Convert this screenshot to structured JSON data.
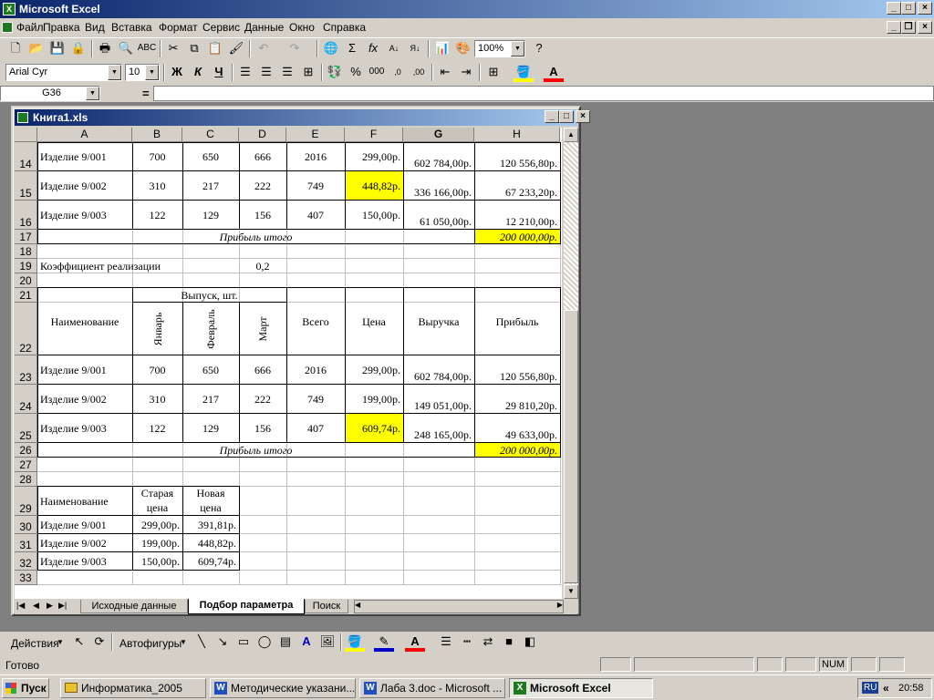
{
  "app": {
    "title": "Microsoft Excel"
  },
  "menu": [
    "Файл",
    "Правка",
    "Вид",
    "Вставка",
    "Формат",
    "Сервис",
    "Данные",
    "Окно",
    "Справка"
  ],
  "toolbar": {
    "zoom": "100%"
  },
  "format": {
    "font": "Arial Cyr",
    "size": "10",
    "thousands": "000"
  },
  "formula_bar": {
    "name_box": "G36",
    "equals": "="
  },
  "workbook": {
    "title": "Книга1.xls"
  },
  "columns": [
    "A",
    "B",
    "C",
    "D",
    "E",
    "F",
    "G",
    "H"
  ],
  "rows": [
    "14",
    "15",
    "16",
    "17",
    "18",
    "19",
    "20",
    "21",
    "22",
    "23",
    "24",
    "25",
    "26",
    "27",
    "28",
    "29",
    "30",
    "31",
    "32",
    "33"
  ],
  "table1": [
    {
      "name": "Изделие 9/001",
      "b": "700",
      "c": "650",
      "d": "666",
      "e": "2016",
      "f": "299,00р.",
      "g": "602 784,00р.",
      "h": "120 556,80р."
    },
    {
      "name": "Изделие 9/002",
      "b": "310",
      "c": "217",
      "d": "222",
      "e": "749",
      "f": "448,82р.",
      "g": "336 166,00р.",
      "h": "67 233,20р."
    },
    {
      "name": "Изделие 9/003",
      "b": "122",
      "c": "129",
      "d": "156",
      "e": "407",
      "f": "150,00р.",
      "g": "61 050,00р.",
      "h": "12 210,00р."
    }
  ],
  "profit_total_label": "Прибыль итого",
  "profit_total_1": "200 000,00р.",
  "coef_label": "Коэффициент реализации",
  "coef_value": "0,2",
  "table2_header": {
    "name": "Наименование",
    "output": "Выпуск, шт.",
    "jan": "Январь",
    "feb": "Февраль",
    "mar": "Март",
    "total": "Всего",
    "price": "Цена",
    "revenue": "Выручка",
    "profit": "Прибыль"
  },
  "table2": [
    {
      "name": "Изделие 9/001",
      "b": "700",
      "c": "650",
      "d": "666",
      "e": "2016",
      "f": "299,00р.",
      "g": "602 784,00р.",
      "h": "120 556,80р."
    },
    {
      "name": "Изделие 9/002",
      "b": "310",
      "c": "217",
      "d": "222",
      "e": "749",
      "f": "199,00р.",
      "g": "149 051,00р.",
      "h": "29 810,20р."
    },
    {
      "name": "Изделие 9/003",
      "b": "122",
      "c": "129",
      "d": "156",
      "e": "407",
      "f": "609,74р.",
      "g": "248 165,00р.",
      "h": "49 633,00р."
    }
  ],
  "profit_total_2": "200 000,00р.",
  "table3_header": {
    "name": "Наименование",
    "old1": "Старая",
    "old2": "цена",
    "new1": "Новая",
    "new2": "цена"
  },
  "table3": [
    {
      "name": "Изделие 9/001",
      "old": "299,00р.",
      "new": "391,81р."
    },
    {
      "name": "Изделие 9/002",
      "old": "199,00р.",
      "new": "448,82р."
    },
    {
      "name": "Изделие 9/003",
      "old": "150,00р.",
      "new": "609,74р."
    }
  ],
  "sheets": [
    "Исходные данные",
    "Подбор параметра",
    "Поиск"
  ],
  "drawing": {
    "actions": "Действия",
    "autoshapes": "Автофигуры"
  },
  "status": {
    "ready": "Готово",
    "num": "NUM"
  },
  "taskbar": {
    "start": "Пуск",
    "items": [
      "Информатика_2005",
      "Методические указани...",
      "Лаба 3.doc - Microsoft ...",
      "Microsoft Excel"
    ],
    "lang": "RU",
    "clock": "20:58"
  },
  "colors": {
    "highlight": "#ffff00",
    "title": "#0a246a"
  }
}
